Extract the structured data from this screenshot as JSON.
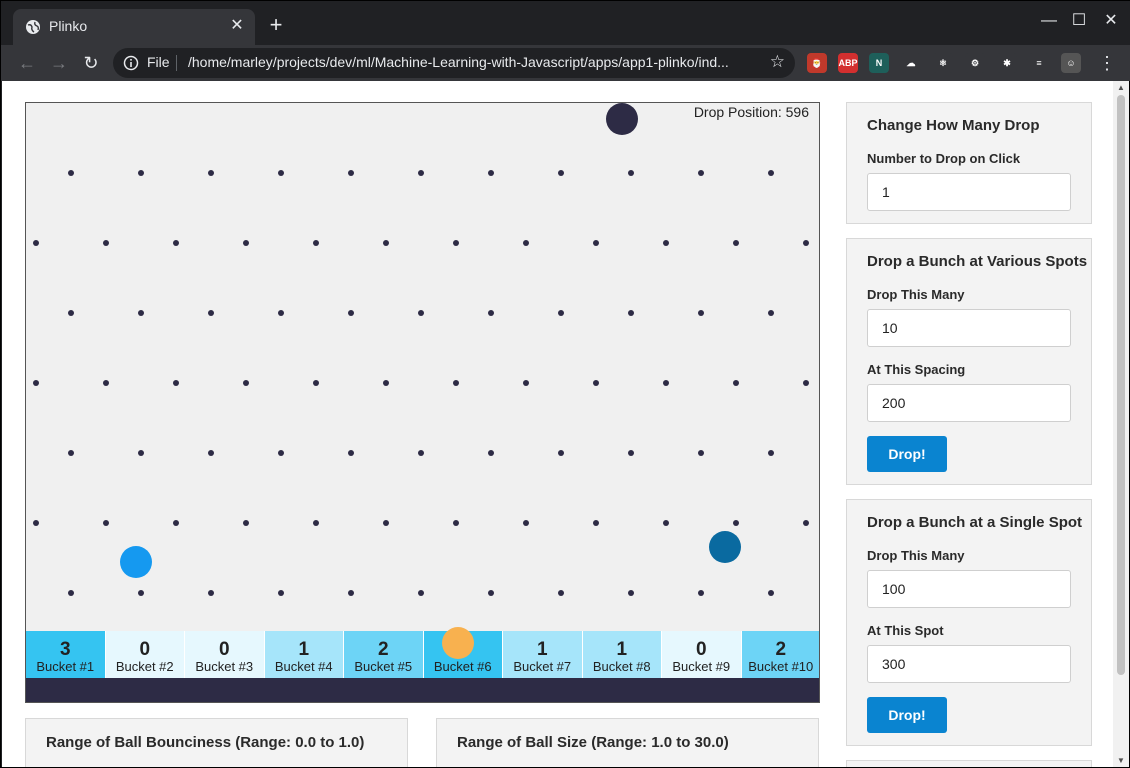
{
  "browser": {
    "tab_title": "Plinko",
    "tab_close": "✕",
    "new_tab": "+",
    "window_controls": {
      "minimize": "—",
      "maximize": "☐",
      "close": "✕"
    },
    "nav": {
      "back": "←",
      "forward": "→",
      "reload": "↻"
    },
    "scheme_label": "File",
    "url": "/home/marley/projects/dev/ml/Machine-Learning-with-Javascript/apps/app1-plinko/ind...",
    "star": "☆",
    "extensions": [
      {
        "name": "santa-extension-icon",
        "label": "🎅",
        "color": "#c0392b"
      },
      {
        "name": "adblock-icon",
        "label": "ABP",
        "color": "#d32f2f"
      },
      {
        "name": "n-extension-icon",
        "label": "N",
        "color": "#1e5f5a"
      },
      {
        "name": "cloud-extension-icon",
        "label": "☁",
        "color": "#35363a"
      },
      {
        "name": "react-devtools-icon",
        "label": "⚛",
        "color": "#35363a"
      },
      {
        "name": "gears-extension-icon",
        "label": "⚙",
        "color": "#35363a"
      },
      {
        "name": "puzzle-extensions-icon",
        "label": "✱",
        "color": "#35363a"
      },
      {
        "name": "media-queue-icon",
        "label": "≡",
        "color": "#35363a"
      },
      {
        "name": "profile-avatar-icon",
        "label": "☺",
        "color": "#555"
      }
    ],
    "menu": "⋮"
  },
  "board": {
    "drop_position_label": "Drop Position: 596",
    "peg_color": "#2d2b45",
    "background": "#f0f0f0",
    "buckets": [
      {
        "count": "3",
        "label": "Bucket #1",
        "color": "#35c4f1"
      },
      {
        "count": "0",
        "label": "Bucket #2",
        "color": "#e6f8fe"
      },
      {
        "count": "0",
        "label": "Bucket #3",
        "color": "#e6f8fe"
      },
      {
        "count": "1",
        "label": "Bucket #4",
        "color": "#a6e5fa"
      },
      {
        "count": "2",
        "label": "Bucket #5",
        "color": "#6dd4f6"
      },
      {
        "count": "3",
        "label": "Bucket #6",
        "color": "#35c4f1"
      },
      {
        "count": "1",
        "label": "Bucket #7",
        "color": "#a6e5fa"
      },
      {
        "count": "1",
        "label": "Bucket #8",
        "color": "#a6e5fa"
      },
      {
        "count": "0",
        "label": "Bucket #9",
        "color": "#e6f8fe"
      },
      {
        "count": "2",
        "label": "Bucket #10",
        "color": "#6dd4f6"
      }
    ],
    "balls": [
      {
        "name": "drop-marker-ball",
        "color": "#2d2b45"
      },
      {
        "name": "falling-ball-blue",
        "color": "#1599f0"
      },
      {
        "name": "falling-ball-dark-blue",
        "color": "#0a6aa0"
      },
      {
        "name": "landed-ball-orange",
        "color": "#f8b14f"
      }
    ]
  },
  "panels": {
    "change_drop": {
      "title": "Change How Many Drop",
      "label": "Number to Drop on Click",
      "value": "1"
    },
    "various_spots": {
      "title": "Drop a Bunch at Various Spots",
      "count_label": "Drop This Many",
      "count_value": "10",
      "spacing_label": "At This Spacing",
      "spacing_value": "200",
      "button": "Drop!"
    },
    "single_spot": {
      "title": "Drop a Bunch at a Single Spot",
      "count_label": "Drop This Many",
      "count_value": "100",
      "spot_label": "At This Spot",
      "spot_value": "300",
      "button": "Drop!"
    },
    "bounciness": {
      "title": "Range of Ball Bounciness (Range: 0.0 to 1.0)"
    },
    "ball_size": {
      "title": "Range of Ball Size (Range: 1.0 to 30.0)"
    }
  },
  "accent_color": "#0a84d0"
}
